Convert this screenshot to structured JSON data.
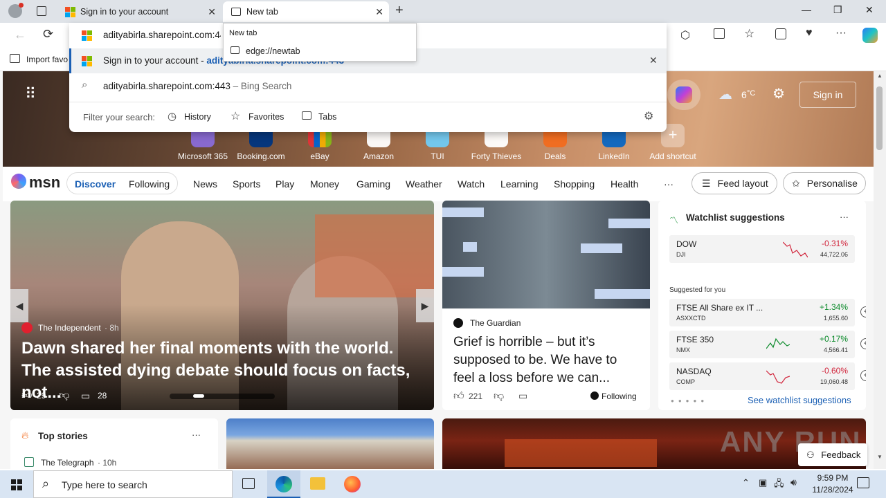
{
  "browser": {
    "tabs": [
      {
        "title": "Sign in to your account",
        "close": "✕"
      },
      {
        "title": "New tab",
        "close": "✕"
      }
    ],
    "new_tab_btn": "+",
    "window": {
      "minimize": "—",
      "maximize": "❐",
      "close": "✕"
    },
    "favorites_bar": {
      "import": "Import favo"
    }
  },
  "omnibox": {
    "current_text": "adityabirla.sharepoint.com:443",
    "suggestions": [
      {
        "title": "Sign in to your account",
        "separator": " - ",
        "url": "adityabirla.sharepoint.com:443"
      },
      {
        "title": "adityabirla.sharepoint.com:443",
        "separator": " – ",
        "source": "Bing Search"
      }
    ],
    "remove": "✕",
    "filter_label": "Filter your search:",
    "filters": [
      "History",
      "Favorites",
      "Tabs"
    ]
  },
  "tab_hover": {
    "title": "New tab",
    "url": "edge://newtab"
  },
  "newtab": {
    "weather": {
      "temp": "6",
      "unit": "°C"
    },
    "signin": "Sign in",
    "shortcuts": [
      {
        "label": "Microsoft 365"
      },
      {
        "label": "Booking.com"
      },
      {
        "label": "eBay"
      },
      {
        "label": "Amazon"
      },
      {
        "label": "TUI"
      },
      {
        "label": "Forty Thieves"
      },
      {
        "label": "Deals"
      },
      {
        "label": "LinkedIn"
      },
      {
        "label": "Add shortcut"
      }
    ],
    "msn": {
      "logo": "msn",
      "tabs": [
        "Discover",
        "Following"
      ],
      "nav": [
        "News",
        "Sports",
        "Play",
        "Money",
        "Gaming",
        "Weather",
        "Watch",
        "Learning",
        "Shopping",
        "Health"
      ],
      "more": "···",
      "feed_layout": "Feed layout",
      "personalise": "Personalise"
    },
    "hero": {
      "source": "The Independent",
      "time": "· 8h",
      "headline": "Dawn shared her final moments with the world. The assisted dying debate should focus on facts, not...",
      "likes": "29",
      "comments": "28"
    },
    "article2": {
      "source": "The Guardian",
      "headline": "Grief is horrible – but it’s supposed to be. We have to feel a loss before we can...",
      "likes": "221",
      "following": "Following"
    },
    "watchlist": {
      "title": "Watchlist suggestions",
      "more": "···",
      "top": {
        "symbol": "DOW",
        "sub": "DJI",
        "pct": "-0.31%",
        "price": "44,722.06"
      },
      "suggested_label": "Suggested for you",
      "items": [
        {
          "symbol": "FTSE All Share ex IT ...",
          "sub": "ASXXCTD",
          "pct": "+1.34%",
          "price": "1,655.60"
        },
        {
          "symbol": "FTSE 350",
          "sub": "NMX",
          "pct": "+0.17%",
          "price": "4,566.41"
        },
        {
          "symbol": "NASDAQ",
          "sub": "COMP",
          "pct": "-0.60%",
          "price": "19,060.48"
        }
      ],
      "see_more": "See watchlist suggestions",
      "colors": {
        "up": "#0b8a2a",
        "down": "#d1243b"
      }
    },
    "top_stories": {
      "title": "Top stories",
      "more": "···",
      "first_source": "The Telegraph",
      "first_time": "· 10h"
    },
    "feedback": "Feedback",
    "watermark": "ANY RUN"
  },
  "taskbar": {
    "search_placeholder": "Type here to search",
    "time": "9:59 PM",
    "date": "11/28/2024"
  }
}
